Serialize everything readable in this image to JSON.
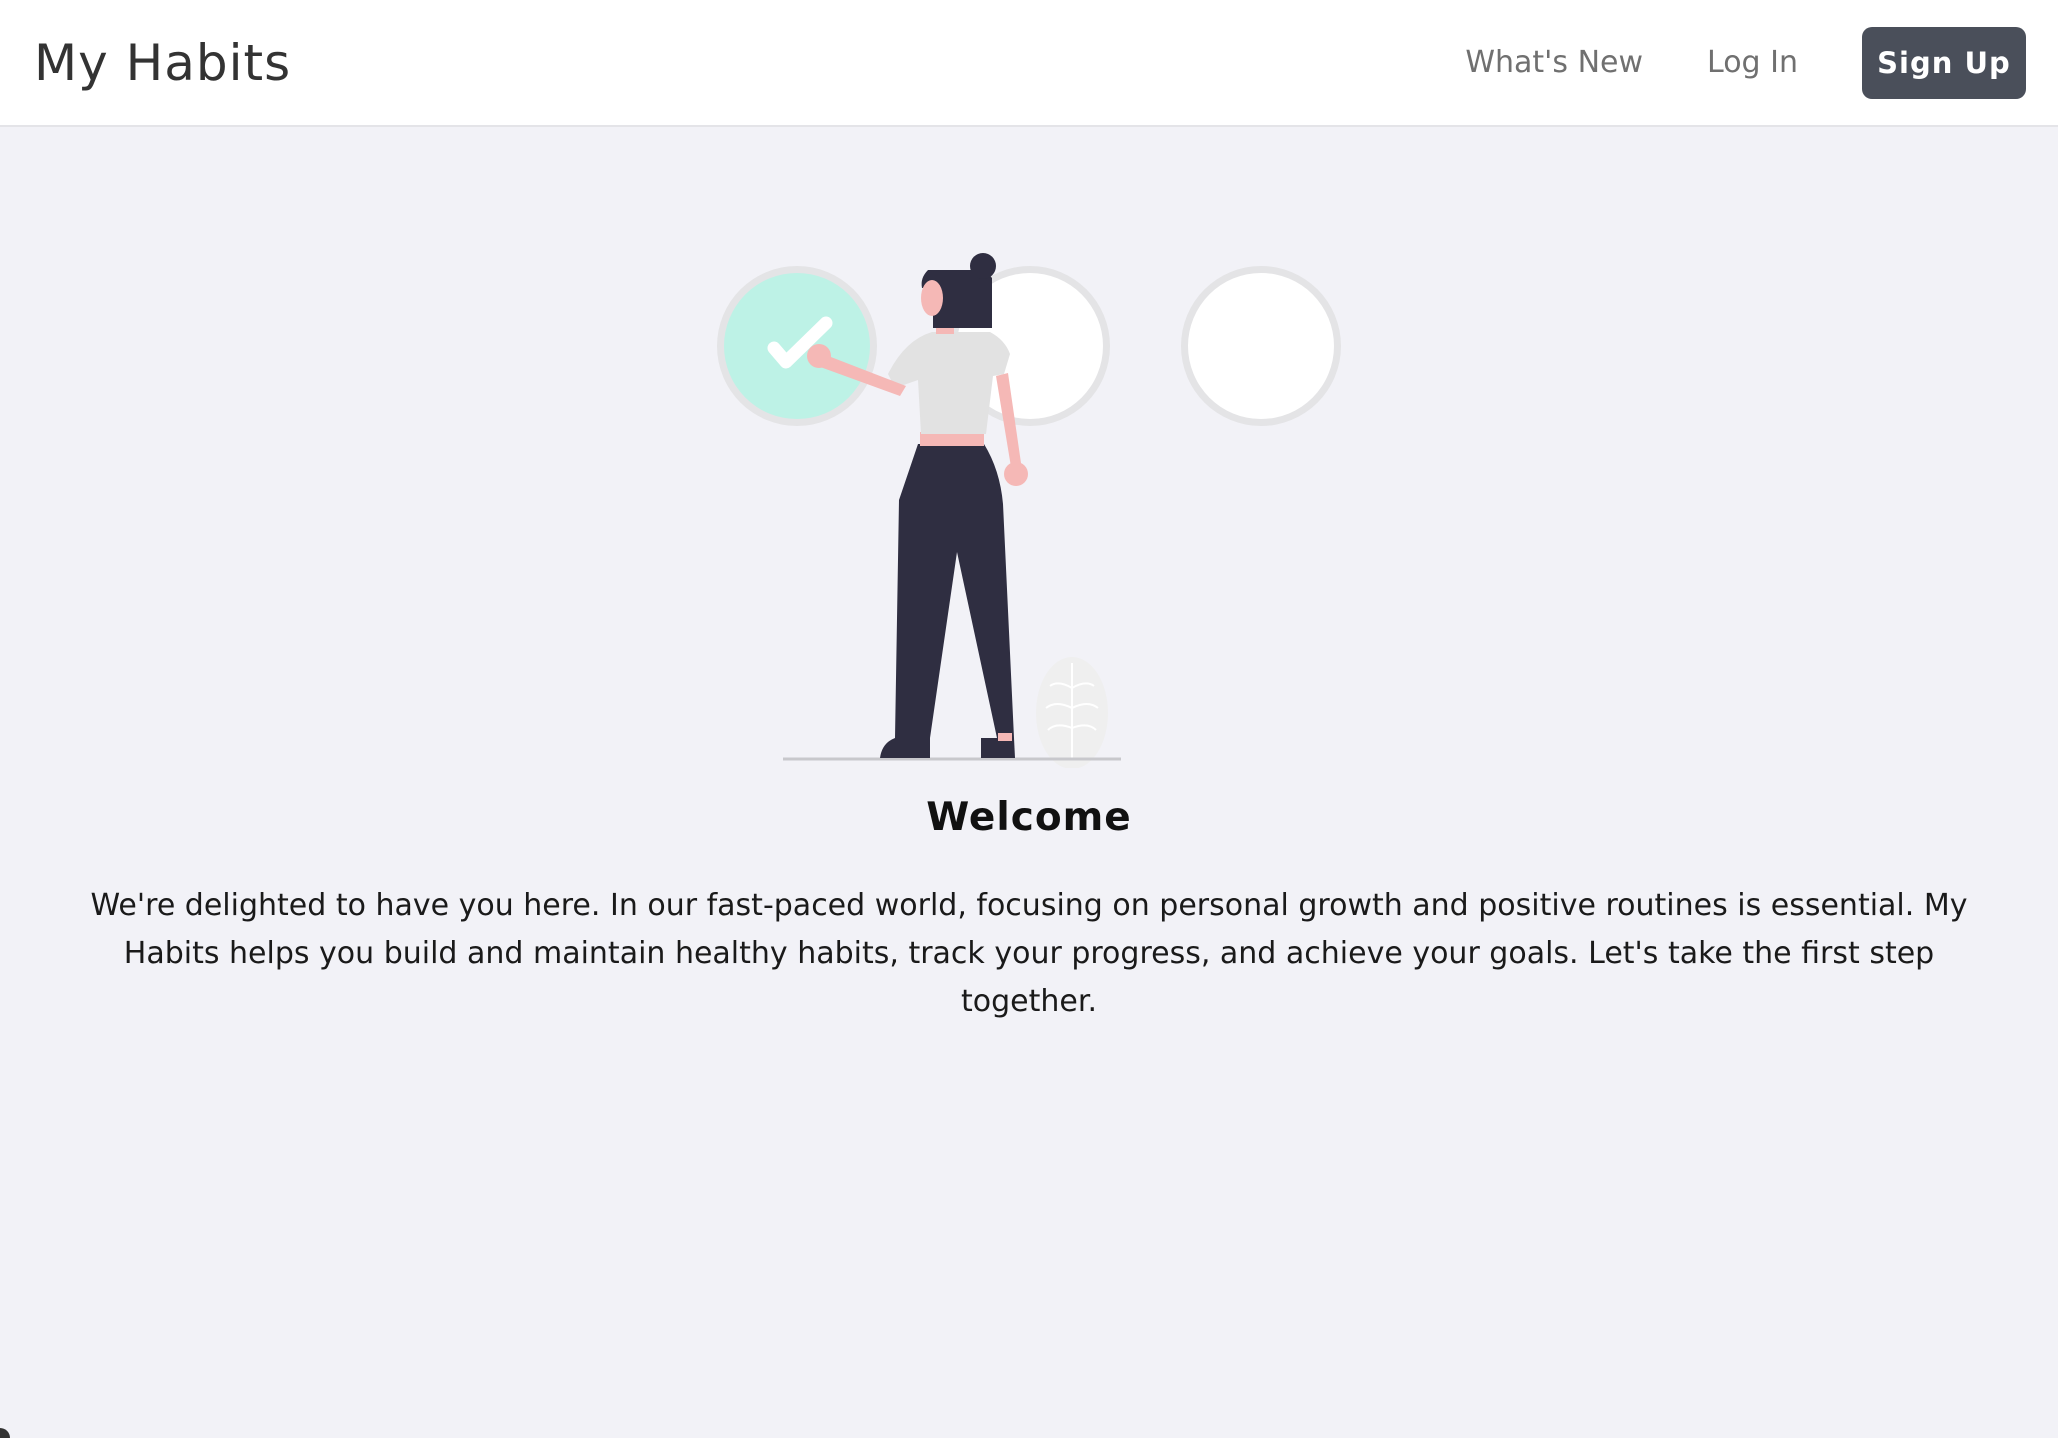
{
  "header": {
    "brand": "My Habits",
    "nav": {
      "whats_new": "What's New",
      "log_in": "Log In",
      "sign_up": "Sign Up"
    }
  },
  "main": {
    "title": "Welcome",
    "description": "We're delighted to have you here. In our fast-paced world, focusing on personal growth and positive routines is essential. My Habits helps you build and maintain healthy habits, track your progress, and achieve your goals. Let's take the first step together."
  },
  "colors": {
    "background": "#f2f2f7",
    "nav_background": "#ffffff",
    "button": "#4a4f5a",
    "accent_circle": "#bdf2e6",
    "figure_dark": "#2f2e41",
    "skin": "#f5b8b6"
  }
}
